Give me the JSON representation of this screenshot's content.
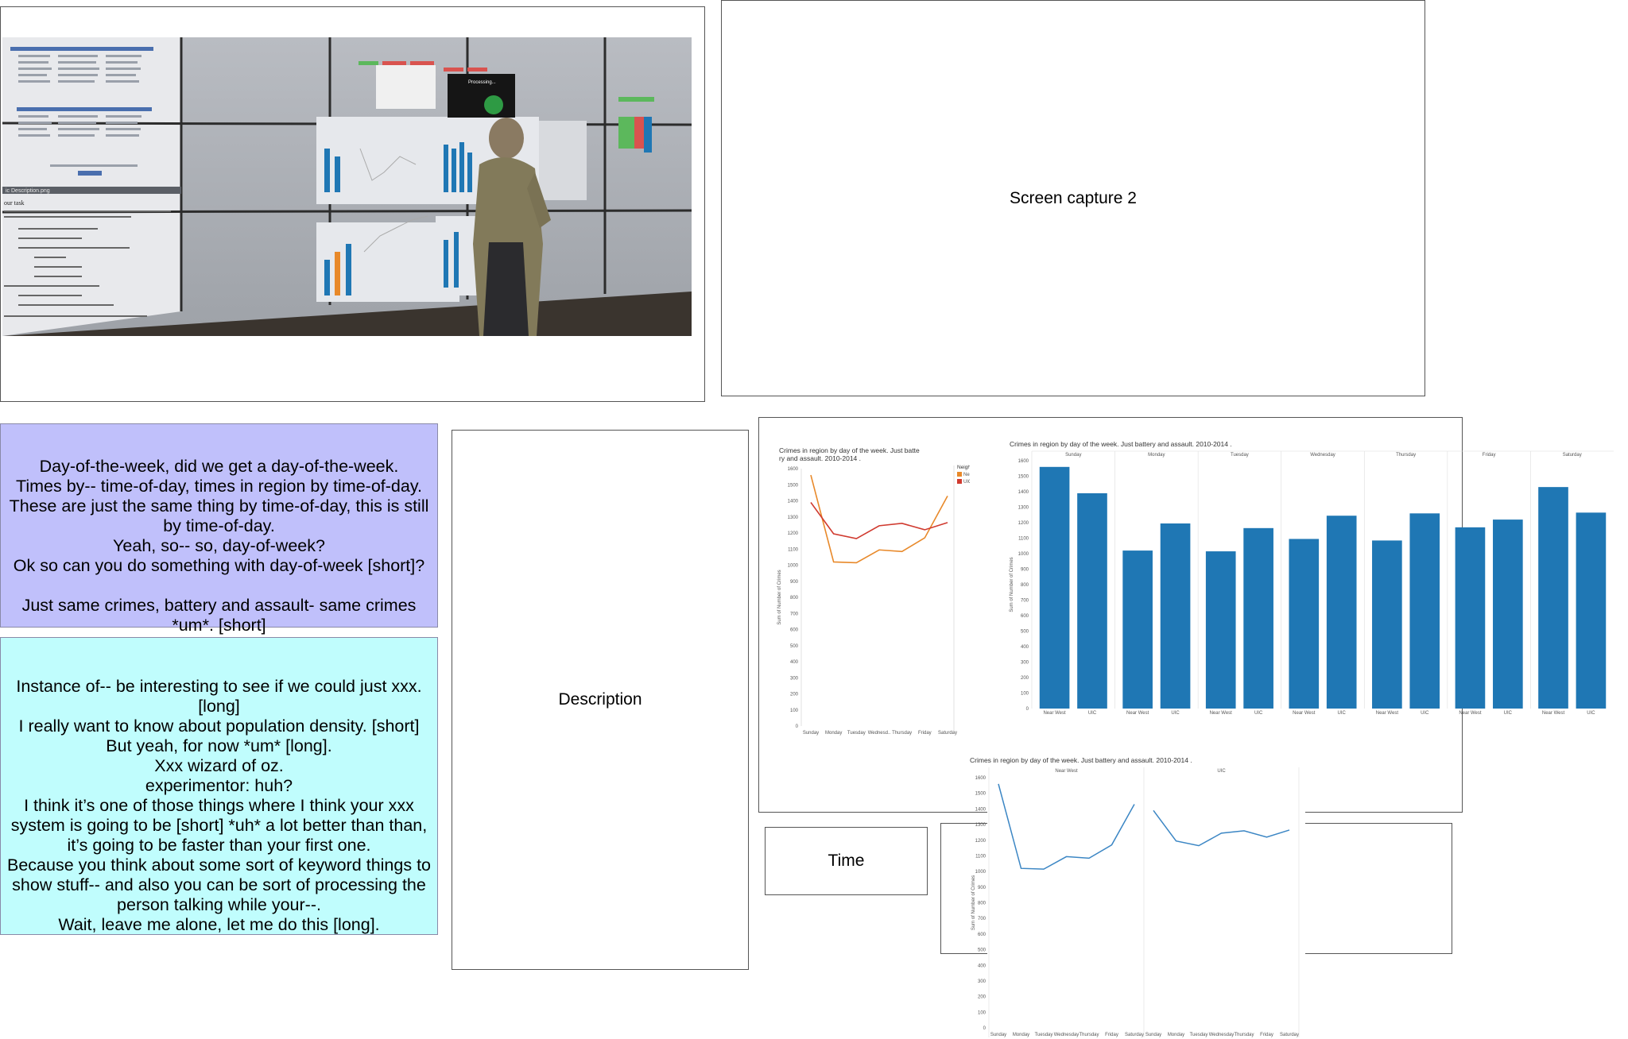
{
  "labels": {
    "screen_capture_2": "Screen capture 2",
    "description": "Description",
    "time": "Time"
  },
  "transcripts": {
    "first": "Day-of-the-week, did we get a day-of-the-week.\nTimes by-- time-of-day, times in region by time-of-day.\nThese are just the same thing by time-of-day, this is still by time-of-day.\nYeah, so-- so, day-of-week?\nOk so can you do something with day-of-week [short]?\n\nJust same crimes, battery and assault- same crimes *um*. [short]",
    "second": "Instance of-- be interesting to see if we could just xxx. [long]\nI really want to know about population density. [short]\nBut yeah, for now *um* [long].\nXxx wizard of oz.\nexperimentor: huh?\nI think it’s one of those things where I think your xxx system is going to be [short] *uh* a lot better than than, it’s going to be faster than your first one.\nBecause you think about some sort of keyword things to show stuff-- and also you can be sort of processing the person talking while your--.\nWait, leave me alone, let me do this [long]."
  },
  "photo": {
    "processing_label": "Processing...",
    "task_heading": "our task",
    "window_title": "ic Description.png"
  },
  "colors": {
    "transcript1_bg": "#c0c0fb",
    "transcript2_bg": "#c0fdfd",
    "bar_blue": "#1f77b4",
    "line_near_west": "#e8892a",
    "line_uic": "#d03a2f",
    "line_blue": "#3b86c4"
  },
  "chart_data": [
    {
      "type": "line",
      "title": "Crimes in region by day of the week.  Just battery and assault.  2010-2014 .",
      "categories": [
        "Sunday",
        "Monday",
        "Tuesday",
        "Wednesday",
        "Thursday",
        "Friday",
        "Saturday"
      ],
      "ylabel": "Sum of Number of Crimes",
      "ylim": [
        0,
        1600
      ],
      "yticks": [
        0,
        100,
        200,
        300,
        400,
        500,
        600,
        700,
        800,
        900,
        1000,
        1100,
        1200,
        1300,
        1400,
        1500,
        1600
      ],
      "legend_title": "Neighborhood",
      "series": [
        {
          "name": "Near West",
          "values": [
            1560,
            1020,
            1015,
            1095,
            1085,
            1170,
            1430
          ]
        },
        {
          "name": "UIC",
          "values": [
            1390,
            1195,
            1165,
            1245,
            1260,
            1220,
            1265
          ]
        }
      ]
    },
    {
      "type": "bar",
      "title": "Crimes in region by day of the week.  Just battery and assault.  2010-2014 .",
      "facets": [
        "Sunday",
        "Monday",
        "Tuesday",
        "Wednesday",
        "Thursday",
        "Friday",
        "Saturday"
      ],
      "categories": [
        "Near West",
        "UIC"
      ],
      "ylabel": "Sum of Number of Crimes",
      "ylim": [
        0,
        1600
      ],
      "yticks": [
        0,
        100,
        200,
        300,
        400,
        500,
        600,
        700,
        800,
        900,
        1000,
        1100,
        1200,
        1300,
        1400,
        1500,
        1600
      ],
      "series": [
        {
          "name": "Near West",
          "values": [
            1560,
            1020,
            1015,
            1095,
            1085,
            1170,
            1430
          ]
        },
        {
          "name": "UIC",
          "values": [
            1390,
            1195,
            1165,
            1245,
            1260,
            1220,
            1265
          ]
        }
      ]
    },
    {
      "type": "line",
      "title": "Crimes in region by day of the week.  Just battery and assault.  2010-2014 .",
      "facets": [
        "Near West",
        "UIC"
      ],
      "categories": [
        "Sunday",
        "Monday",
        "Tuesday",
        "Wednesday",
        "Thursday",
        "Friday",
        "Saturday"
      ],
      "ylabel": "Sum of Number of Crimes",
      "ylim": [
        0,
        1600
      ],
      "yticks": [
        0,
        100,
        200,
        300,
        400,
        500,
        600,
        700,
        800,
        900,
        1000,
        1100,
        1200,
        1300,
        1400,
        1500,
        1600
      ],
      "series": [
        {
          "name": "Near West",
          "values": [
            1560,
            1020,
            1015,
            1095,
            1085,
            1170,
            1430
          ]
        },
        {
          "name": "UIC",
          "values": [
            1390,
            1195,
            1165,
            1245,
            1260,
            1220,
            1265
          ]
        }
      ]
    }
  ]
}
